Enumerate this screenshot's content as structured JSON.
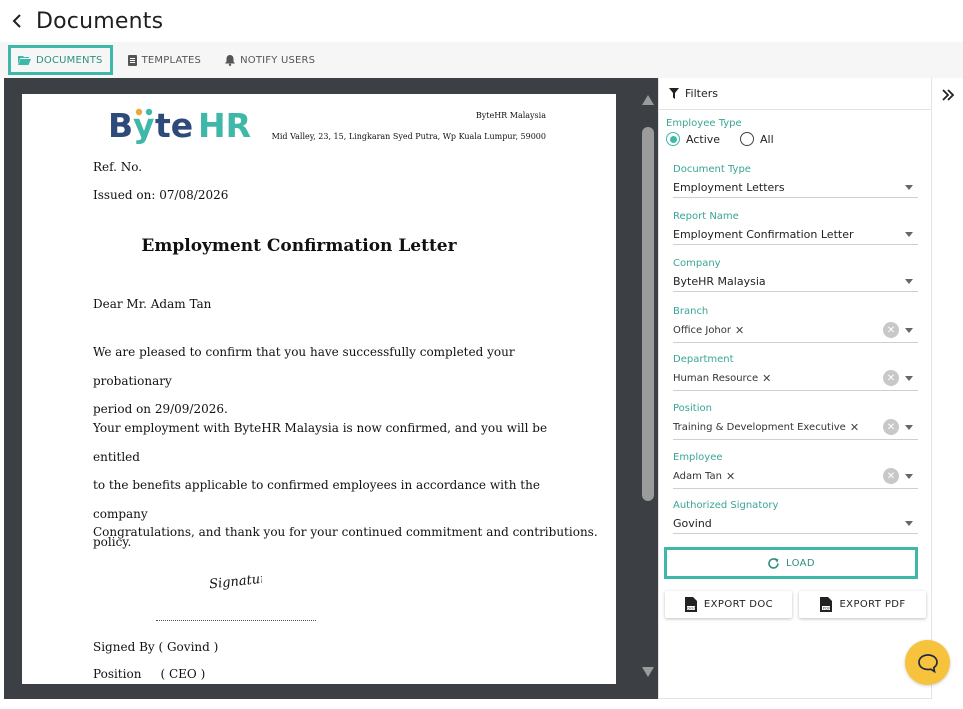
{
  "header": {
    "title": "Documents"
  },
  "tabs": [
    {
      "label": "DOCUMENTS",
      "active": true
    },
    {
      "label": "TEMPLATES",
      "active": false
    },
    {
      "label": "NOTIFY USERS",
      "active": false
    }
  ],
  "document": {
    "logo_text": "ByteHR",
    "company_name": "ByteHR Malaysia",
    "company_address": "Mid Valley, 23, 15, Lingkaran Syed Putra, Wp Kuala Lumpur, 59000",
    "ref_no": "Ref. No.",
    "issued_on": "Issued on: 07/08/2026",
    "title": "Employment Confirmation Letter",
    "greeting": "Dear Mr. Adam Tan",
    "para1_line1": "We are pleased to confirm that you have successfully completed your probationary",
    "para1_line2": "period on 29/09/2026.",
    "para2_line1": "Your employment with ByteHR Malaysia is now confirmed, and you will be entitled",
    "para2_line2": "to the benefits applicable to confirmed employees in accordance with the company",
    "para2_line3": "policy.",
    "para3": "Congratulations, and thank you for your continued commitment and contributions.",
    "signature_text": "Signature",
    "signed_by": "Signed By ( Govind )",
    "position": "Position     ( CEO )"
  },
  "filters": {
    "heading": "Filters",
    "employee_type": {
      "label": "Employee Type",
      "options": [
        "Active",
        "All"
      ],
      "selected": "Active"
    },
    "document_type": {
      "label": "Document Type",
      "value": "Employment Letters"
    },
    "report_name": {
      "label": "Report Name",
      "value": "Employment Confirmation Letter"
    },
    "company": {
      "label": "Company",
      "value": "ByteHR Malaysia"
    },
    "branch": {
      "label": "Branch",
      "chip": "Office Johor"
    },
    "department": {
      "label": "Department",
      "chip": "Human Resource"
    },
    "position": {
      "label": "Position",
      "chip": "Training & Development Executive"
    },
    "employee": {
      "label": "Employee",
      "chip": "Adam Tan"
    },
    "authorized_signatory": {
      "label": "Authorized Signatory",
      "value": "Govind"
    },
    "load_label": "LOAD",
    "export_doc_label": "EXPORT DOC",
    "export_pdf_label": "EXPORT PDF"
  },
  "colors": {
    "accent": "#3fb8a9",
    "accent_text": "#2f8f83",
    "preview_bg": "#3c3f43",
    "chat": "#f7c33c",
    "logo_blue": "#2e4a7a",
    "logo_teal": "#3fb8a9"
  }
}
